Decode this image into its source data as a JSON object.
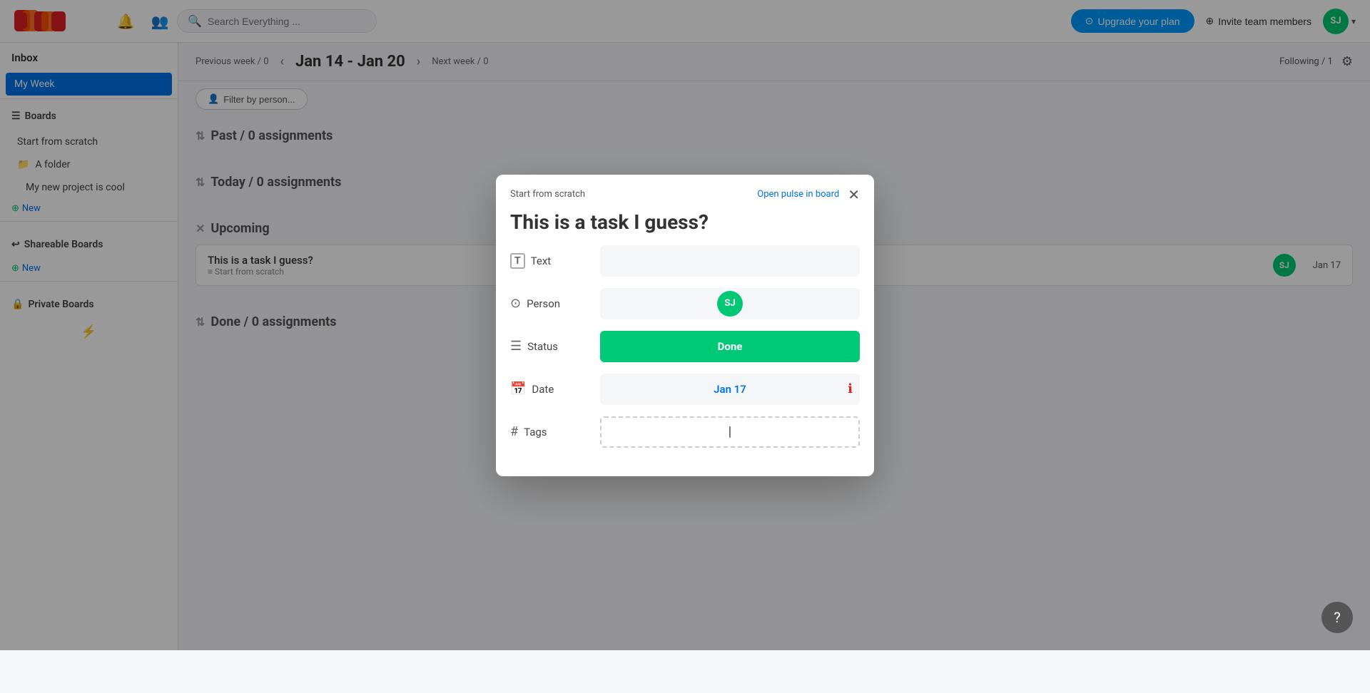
{
  "app": {
    "title": "Monday.com"
  },
  "navbar": {
    "search_placeholder": "Search Everything ...",
    "upgrade_label": "Upgrade your plan",
    "invite_label": "Invite team members",
    "avatar_initials": "SJ"
  },
  "sidebar": {
    "inbox_label": "Inbox",
    "my_week_label": "My Week",
    "boards_label": "Boards",
    "start_from_scratch_label": "Start from scratch",
    "a_folder_label": "A folder",
    "my_new_project_label": "My new project is cool",
    "new_label": "New",
    "shareable_boards_label": "Shareable Boards",
    "new_shareable_label": "New",
    "private_boards_label": "Private Boards",
    "lightning_icon": "⚡"
  },
  "week_header": {
    "prev_week": "Previous week / 0",
    "date_range": "Jan 14 - Jan 20",
    "next_week": "Next week / 0",
    "following": "Following / 1"
  },
  "main": {
    "filter_label": "Filter by person...",
    "past_section": "Past / 0 assignments",
    "today_section": "Today / 0 assignments",
    "upcoming_section": "Upcoming",
    "done_section": "Done / 0 assignments"
  },
  "upcoming_task": {
    "title": "This is a task I guess?",
    "subtitle": "≡ Start from scratch",
    "avatar_initials": "SJ",
    "date": "Jan 17"
  },
  "modal": {
    "breadcrumb": "Start from scratch",
    "open_in_board_label": "Open pulse in board",
    "close_icon": "✕",
    "title": "This is a task I guess?",
    "fields": {
      "text_label": "Text",
      "text_icon": "T",
      "person_label": "Person",
      "person_icon": "person",
      "person_avatar": "SJ",
      "status_label": "Status",
      "status_icon": "≡",
      "status_value": "Done",
      "date_label": "Date",
      "date_icon": "calendar",
      "date_value": "Jan 17",
      "tags_label": "Tags",
      "tags_icon": "#"
    }
  },
  "help_btn": "?",
  "colors": {
    "brand_blue": "#0073ea",
    "brand_green": "#00c875",
    "status_done": "#00c875",
    "accent_red": "#e02020",
    "warning": "#ff6b6b"
  }
}
